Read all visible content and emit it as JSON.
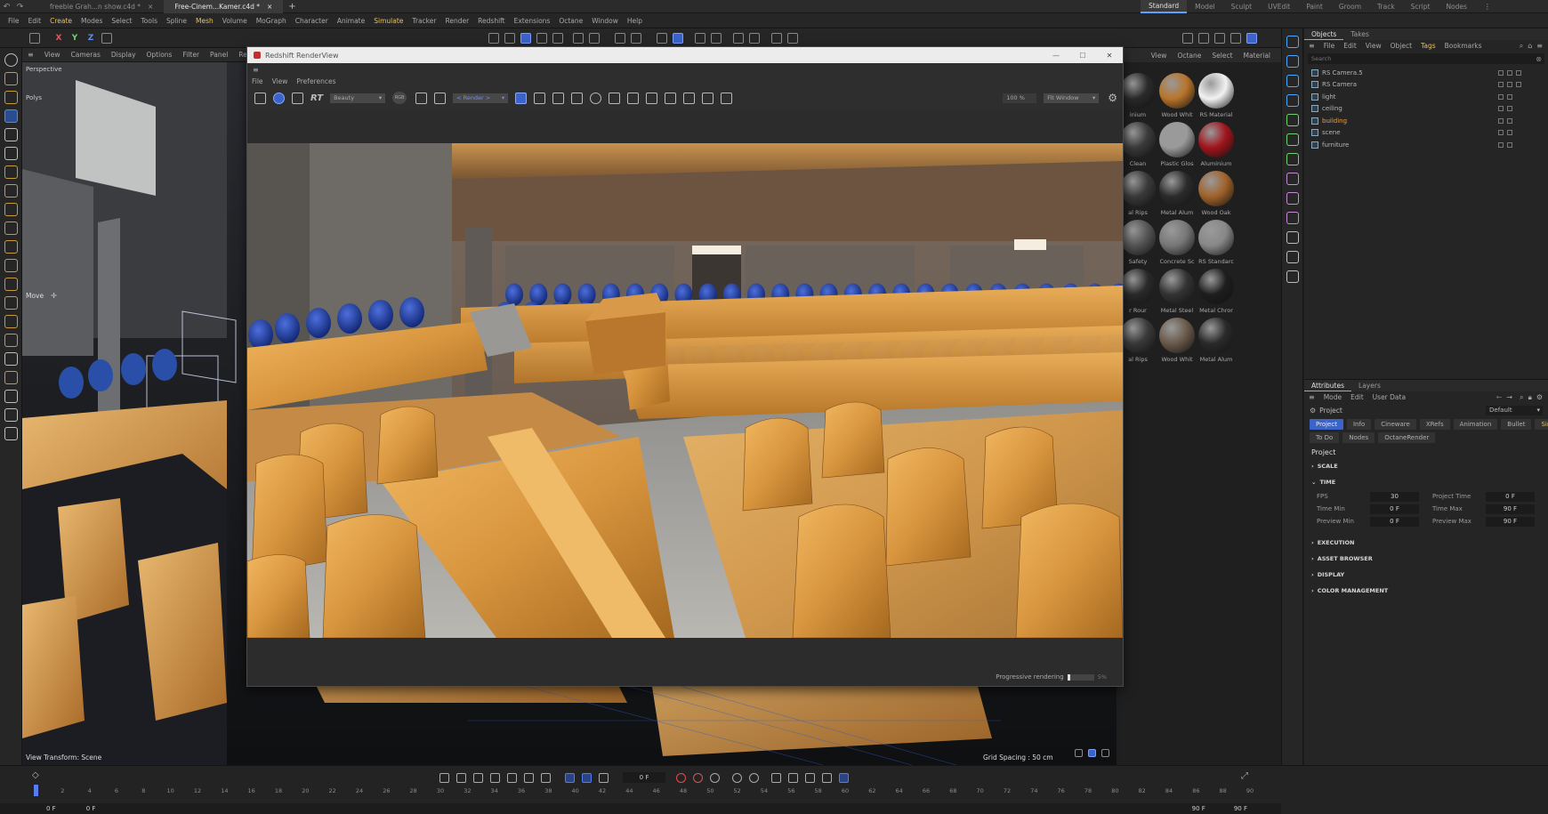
{
  "doc_tabs": [
    {
      "label": "freebie Grah...n show.c4d *",
      "active": false
    },
    {
      "label": "Free-Cinem...Kamer.c4d *",
      "active": true
    }
  ],
  "layouts": [
    "Standard",
    "Model",
    "Sculpt",
    "UVEdit",
    "Paint",
    "Groom",
    "Track",
    "Script",
    "Nodes"
  ],
  "menu": [
    "File",
    "Edit",
    "Create",
    "Modes",
    "Select",
    "Tools",
    "Spline",
    "Mesh",
    "Volume",
    "MoGraph",
    "Character",
    "Animate",
    "Simulate",
    "Tracker",
    "Render",
    "Redshift",
    "Extensions",
    "Octane",
    "Window",
    "Help"
  ],
  "viewport": {
    "menu": [
      "View",
      "Cameras",
      "Display",
      "Options",
      "Filter",
      "Panel",
      "Redshift"
    ],
    "axes": [
      "X",
      "Y",
      "Z"
    ],
    "move_label": "Move",
    "view_transform": "View Transform: Scene",
    "grid_spacing": "Grid Spacing : 50 cm",
    "perspective": "Perspective",
    "polys": "Polys"
  },
  "material_menu": [
    "View",
    "Octane",
    "Select",
    "Material"
  ],
  "materials": [
    {
      "name": "inium",
      "color": "#2a2a2a"
    },
    {
      "name": "Wood Whit",
      "color": "#b8742a"
    },
    {
      "name": "RS Material",
      "color": "#f2f2f2"
    },
    {
      "name": "Clean",
      "color": "#3a3a3a"
    },
    {
      "name": "Plastic Glos",
      "color": "#9a9a9a"
    },
    {
      "name": "Aluminium",
      "color": "#a0141c"
    },
    {
      "name": "al Rips",
      "color": "#3a3a3a"
    },
    {
      "name": "Metal Alum",
      "color": "#2b2b2b"
    },
    {
      "name": "Wood Oak",
      "color": "#a0622a"
    },
    {
      "name": "Safety",
      "color": "#555555"
    },
    {
      "name": "Concrete Sc",
      "color": "#777777"
    },
    {
      "name": "RS Standarc",
      "color": "#888888"
    },
    {
      "name": "r Rour",
      "color": "#2a2a2a"
    },
    {
      "name": "Metal Steel",
      "color": "#333333"
    },
    {
      "name": "Metal Chror",
      "color": "#1e1e1e"
    },
    {
      "name": "al Rips",
      "color": "#3a3a3a"
    },
    {
      "name": "Wood Whit",
      "color": "#6a5a4a"
    },
    {
      "name": "Metal Alum",
      "color": "#2a2a2a"
    }
  ],
  "renderview": {
    "title": "Redshift RenderView",
    "menu": [
      "File",
      "View",
      "Preferences"
    ],
    "rt_label": "RT",
    "aov": "Beauty",
    "display": "RGB",
    "render_mode": "< Render >",
    "zoom": "100 %",
    "fit": "Fit Window",
    "status": "Progressive rendering",
    "progress": "5%"
  },
  "objects_panel": {
    "tabs": [
      "Objects",
      "Takes"
    ],
    "menu": [
      "File",
      "Edit",
      "View",
      "Object",
      "Tags",
      "Bookmarks"
    ],
    "search_placeholder": "Search",
    "items": [
      {
        "name": "RS Camera.5",
        "hl": false
      },
      {
        "name": "RS Camera",
        "hl": false
      },
      {
        "name": "light",
        "hl": false
      },
      {
        "name": "ceiling",
        "hl": false
      },
      {
        "name": "building",
        "hl": true
      },
      {
        "name": "scene",
        "hl": false
      },
      {
        "name": "furniture",
        "hl": false
      }
    ]
  },
  "attributes": {
    "tabs": [
      "Attributes",
      "Layers"
    ],
    "menu": [
      "Mode",
      "Edit",
      "User Data"
    ],
    "object": "Project",
    "preset": "Default",
    "tabs_row1": [
      {
        "label": "Project",
        "on": true
      },
      {
        "label": "Info",
        "on": false
      },
      {
        "label": "Cineware",
        "on": false
      },
      {
        "label": "XRefs",
        "on": false
      },
      {
        "label": "Animation",
        "on": false
      },
      {
        "label": "Bullet",
        "on": false
      },
      {
        "label": "Simulation",
        "on": false
      }
    ],
    "tabs_row2": [
      "To Do",
      "Nodes",
      "OctaneRender"
    ],
    "heading": "Project",
    "scale": "SCALE",
    "time": "TIME",
    "fields": {
      "fps_label": "FPS",
      "fps": "30",
      "project_time_label": "Project Time",
      "project_time": "0 F",
      "time_min_label": "Time Min",
      "time_min": "0 F",
      "time_max_label": "Time Max",
      "time_max": "90 F",
      "preview_min_label": "Preview Min",
      "preview_min": "0 F",
      "preview_max_label": "Preview Max",
      "preview_max": "90 F"
    },
    "sections": [
      "EXECUTION",
      "ASSET BROWSER",
      "DISPLAY",
      "COLOR MANAGEMENT"
    ]
  },
  "timeline": {
    "current_frame": "0 F",
    "ticks": [
      "0",
      "2",
      "4",
      "6",
      "8",
      "10",
      "12",
      "14",
      "16",
      "18",
      "20",
      "22",
      "24",
      "26",
      "28",
      "30",
      "32",
      "34",
      "36",
      "38",
      "40",
      "42",
      "44",
      "46",
      "48",
      "50",
      "52",
      "54",
      "56",
      "58",
      "60",
      "62",
      "64",
      "66",
      "68",
      "70",
      "72",
      "74",
      "76",
      "78",
      "80",
      "82",
      "84",
      "86",
      "88",
      "90"
    ],
    "start": "0 F",
    "start2": "0 F",
    "end": "90 F",
    "end2": "90 F"
  },
  "colors": {
    "accent": "#3b63c9",
    "highlight": "#e8c25c",
    "wood": "#d49a4a",
    "seat_blue": "#1e3d9c"
  }
}
